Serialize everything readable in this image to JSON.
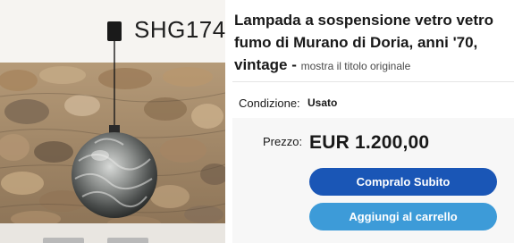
{
  "photo": {
    "overlay_code": "SHG174"
  },
  "listing": {
    "title": "Lampada a sospensione vetro vetro fumo di Murano di Doria, anni '70, vintage - ",
    "original_title_link": "mostra il titolo originale",
    "condition_label": "Condizione:",
    "condition_value": "Usato",
    "price_label": "Prezzo:",
    "price_value": "EUR 1.200,00"
  },
  "actions": {
    "buy_now_label": "Compralo Subito",
    "add_to_cart_label": "Aggiungi al carrello"
  },
  "colors": {
    "buy_now_button": "#1a56b6",
    "add_to_cart_button": "#3d9bd8",
    "price_panel_bg": "#f7f7f7"
  }
}
